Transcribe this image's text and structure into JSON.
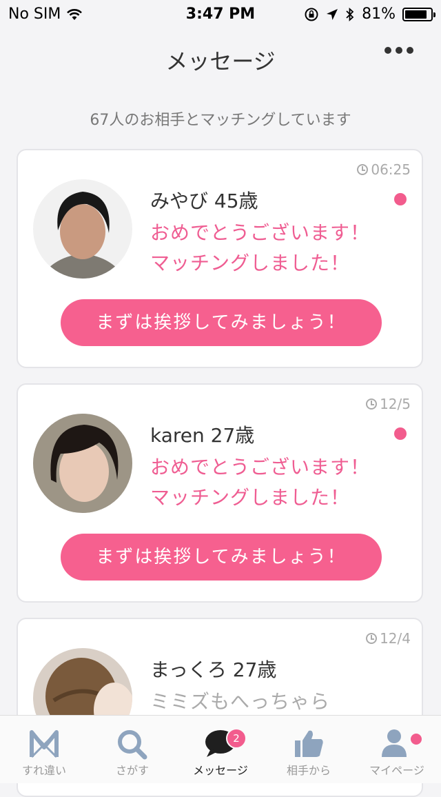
{
  "status": {
    "carrier": "No SIM",
    "time": "3:47 PM",
    "battery": "81%",
    "battery_level": 0.81
  },
  "header": {
    "title": "メッセージ"
  },
  "summary": "67人のお相手とマッチングしています",
  "matches": [
    {
      "time": "06:25",
      "name": "みやび 45歳",
      "line1": "おめでとうございます！",
      "line2": "マッチングしました！",
      "cta": "まずは挨拶してみましょう！"
    },
    {
      "time": "12/5",
      "name": "karen 27歳",
      "line1": "おめでとうございます！",
      "line2": "マッチングしました！",
      "cta": "まずは挨拶してみましょう！"
    },
    {
      "time": "12/4",
      "name": "まっくろ 27歳",
      "line1": "ミミズもへっちゃら"
    }
  ],
  "tabs": [
    {
      "label": "すれ違い",
      "icon": "passing-icon"
    },
    {
      "label": "さがす",
      "icon": "search-icon"
    },
    {
      "label": "メッセージ",
      "icon": "chat-icon",
      "badge": "2"
    },
    {
      "label": "相手から",
      "icon": "thumbs-up-icon"
    },
    {
      "label": "マイページ",
      "icon": "user-icon"
    }
  ],
  "colors": {
    "accent": "#f6608f",
    "message_pink": "#ef5d92"
  }
}
